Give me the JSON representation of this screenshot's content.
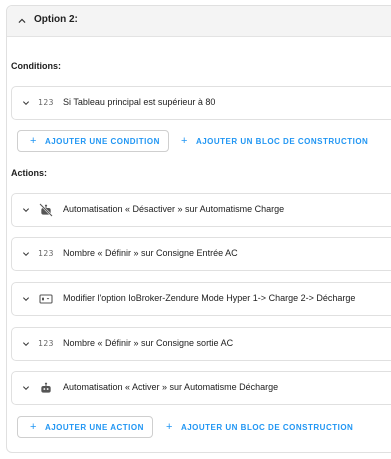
{
  "header": {
    "title": "Option 2:"
  },
  "conditions": {
    "label": "Conditions:",
    "items": [
      {
        "icon": "number-123-icon",
        "icon_text": "123",
        "text": "Si Tableau principal est supérieur à 80"
      }
    ],
    "add_button": "AJOUTER UNE CONDITION",
    "add_block_button": "AJOUTER UN BLOC DE CONSTRUCTION"
  },
  "actions": {
    "label": "Actions:",
    "items": [
      {
        "icon": "robot-off-icon",
        "text": "Automatisation « Désactiver » sur Automatisme Charge"
      },
      {
        "icon": "number-123-icon",
        "icon_text": "123",
        "text": "Nombre « Définir » sur Consigne Entrée AC"
      },
      {
        "icon": "form-dropdown-icon",
        "text": "Modifier l'option IoBroker-Zendure Mode Hyper 1-> Charge 2-> Décharge"
      },
      {
        "icon": "number-123-icon",
        "icon_text": "123",
        "text": "Nombre « Définir » sur Consigne sortie AC"
      },
      {
        "icon": "robot-icon",
        "text": "Automatisation « Activer » sur Automatisme Décharge"
      }
    ],
    "add_button": "AJOUTER UNE ACTION",
    "add_block_button": "AJOUTER UN BLOC DE CONSTRUCTION"
  },
  "colors": {
    "accent": "#2196f3",
    "text": "#212121",
    "border": "#e0e0e0",
    "header_bg": "#f4f4f4"
  }
}
